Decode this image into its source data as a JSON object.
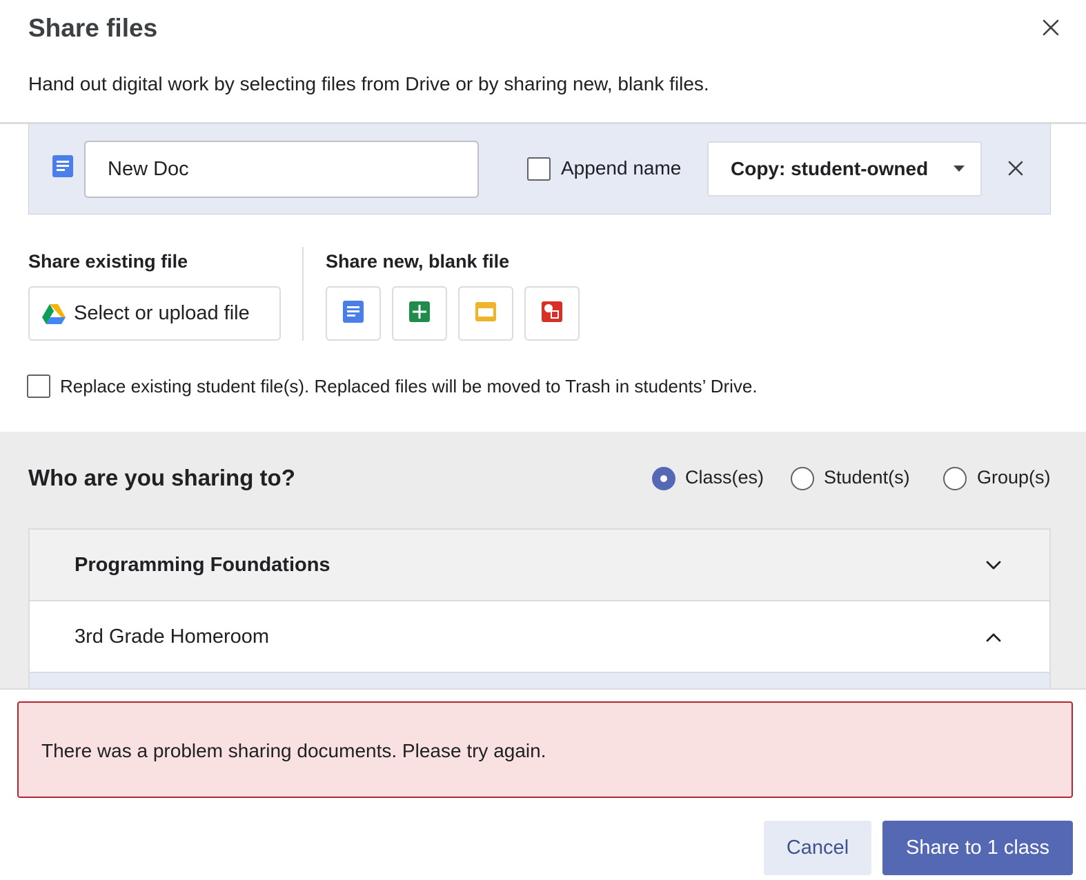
{
  "dialog": {
    "title": "Share files",
    "description": "Hand out digital work by selecting files from Drive or by sharing new, blank files."
  },
  "file_row": {
    "icon": "docs-icon",
    "name_value": "New Doc",
    "append_name_label": "Append name",
    "append_name_checked": false,
    "copy_mode": "Copy: student-owned"
  },
  "share_existing": {
    "label": "Share existing file",
    "button_label": "Select or upload file",
    "icon": "google-drive-icon"
  },
  "share_new": {
    "label": "Share new, blank file",
    "types": [
      {
        "name": "docs",
        "color": "#4a7ee8"
      },
      {
        "name": "sheets",
        "color": "#1f8c4c"
      },
      {
        "name": "slides",
        "color": "#f0b429"
      },
      {
        "name": "drawings",
        "color": "#d93025"
      }
    ]
  },
  "replace": {
    "label": "Replace existing student file(s). Replaced files will be moved to Trash in students’ Drive.",
    "checked": false
  },
  "recipients": {
    "title": "Who are you sharing to?",
    "options": [
      {
        "label": "Class(es)",
        "selected": true
      },
      {
        "label": "Student(s)",
        "selected": false
      },
      {
        "label": "Group(s)",
        "selected": false
      }
    ],
    "classes": [
      {
        "name": "Programming Foundations",
        "expanded": false
      },
      {
        "name": "3rd Grade Homeroom",
        "expanded": true
      }
    ]
  },
  "error": {
    "message": "There was a problem sharing documents. Please try again."
  },
  "footer": {
    "cancel_label": "Cancel",
    "share_label": "Share to 1 class"
  }
}
